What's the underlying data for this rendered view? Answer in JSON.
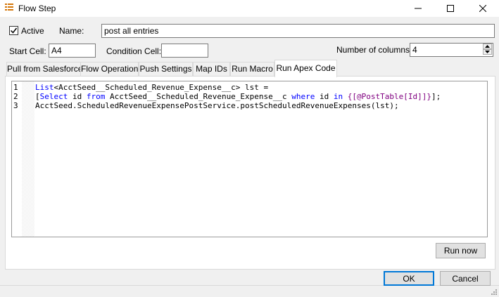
{
  "window": {
    "title": "Flow Step"
  },
  "form": {
    "active_label": "Active",
    "active_checked": true,
    "name_label": "Name:",
    "name_value": "post all entries",
    "start_cell_label": "Start Cell:",
    "start_cell_value": "A4",
    "condition_cell_label": "Condition Cell:",
    "condition_cell_value": "",
    "num_columns_label": "Number of columns:",
    "num_columns_value": "4"
  },
  "tabs": [
    {
      "label": "Pull from Salesforce"
    },
    {
      "label": "Flow Operation"
    },
    {
      "label": "Push Settings"
    },
    {
      "label": "Map IDs"
    },
    {
      "label": "Run Macro"
    },
    {
      "label": "Run Apex Code",
      "active": true
    }
  ],
  "editor": {
    "line_numbers": [
      "1",
      "2",
      "3"
    ],
    "lines": [
      "List<AcctSeed__Scheduled_Revenue_Expense__c> lst =",
      "[Select id from AcctSeed__Scheduled_Revenue_Expense__c where id in {[@PostTable[Id]]}];",
      "AcctSeed.ScheduledRevenueExpensePostService.postScheduledRevenueExpenses(lst);"
    ]
  },
  "buttons": {
    "run_now": "Run now",
    "ok": "OK",
    "cancel": "Cancel"
  },
  "colors": {
    "keyword": "#0000ff",
    "text": "#000000",
    "bracket": "#800080",
    "focus": "#0078d7"
  }
}
